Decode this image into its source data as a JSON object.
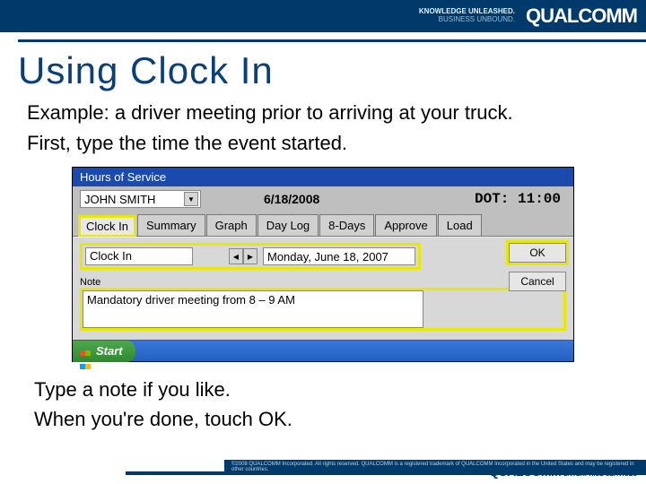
{
  "header": {
    "tagline_top": "KNOWLEDGE UNLEASHED.",
    "tagline_bot": "BUSINESS UNBOUND.",
    "brand": "QUALCOMM"
  },
  "title": "Using Clock In",
  "intro_line1": "Example: a driver meeting prior to arriving at your truck.",
  "intro_line2": "First, type the time the event started.",
  "mock": {
    "window_title": "Hours of Service",
    "driver_name": "JOHN SMITH",
    "date_header": "6/18/2008",
    "dot": "DOT: 11:00",
    "tabs": {
      "clock_in": "Clock In",
      "summary": "Summary",
      "graph": "Graph",
      "day_log": "Day Log",
      "eight_days": "8-Days",
      "approve": "Approve",
      "load": "Load"
    },
    "clock_in_field": "Clock In",
    "date_nav_prev": "◀",
    "date_nav_next": "▶",
    "date_full": "Monday, June 18, 2007",
    "note_label": "Note",
    "note_value": "Mandatory driver meeting from 8 – 9 AM",
    "ok": "OK",
    "cancel": "Cancel",
    "start": "Start"
  },
  "outro_line1": "Type a note if you like.",
  "outro_line2": "When you're done, touch OK.",
  "footer": {
    "copy": "©2008 QUALCOMM Incorporated. All rights reserved. QUALCOMM is a registered trademark of QUALCOMM Incorporated in the United States and may be registered in other countries.",
    "brand": "QUALCOMM",
    "brand_sub": "ENTERPRISE SERVICES"
  }
}
